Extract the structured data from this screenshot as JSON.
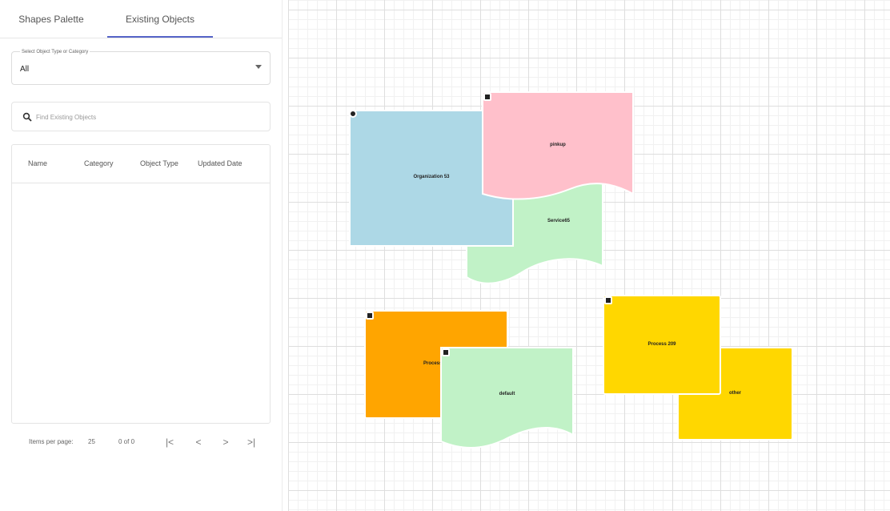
{
  "tabs": {
    "shapes_palette": "Shapes Palette",
    "existing_objects": "Existing Objects"
  },
  "filter": {
    "label": "Select Object Type or Category",
    "value": "All"
  },
  "search": {
    "placeholder": "Find Existing Objects",
    "value": ""
  },
  "table": {
    "columns": [
      "Name",
      "Category",
      "Object Type",
      "Updated Date"
    ],
    "rows": []
  },
  "paginator": {
    "items_label": "Items per page:",
    "page_size": "25",
    "range": "0 of 0",
    "first": "|<",
    "prev": "<",
    "next": ">",
    "last": ">|"
  },
  "canvas": {
    "shapes": [
      {
        "id": "organization",
        "label": "Organization 53",
        "color": "#add8e6",
        "icon": "organization-icon"
      },
      {
        "id": "pink-doc",
        "label": "pinkup",
        "color": "#ffc0cb",
        "icon": "document-icon"
      },
      {
        "id": "service-doc",
        "label": "Service65",
        "color": "#c1f2c7",
        "icon": ""
      },
      {
        "id": "orange-proc",
        "label": "Process",
        "color": "#ffa500",
        "icon": "process-icon"
      },
      {
        "id": "green-doc",
        "label": "default",
        "color": "#c1f2c7",
        "icon": "document-icon"
      },
      {
        "id": "yellow-proc",
        "label": "Process 209",
        "color": "#ffd700",
        "icon": "process-icon"
      },
      {
        "id": "yellow-small",
        "label": "other",
        "color": "#ffd700",
        "icon": ""
      }
    ]
  }
}
